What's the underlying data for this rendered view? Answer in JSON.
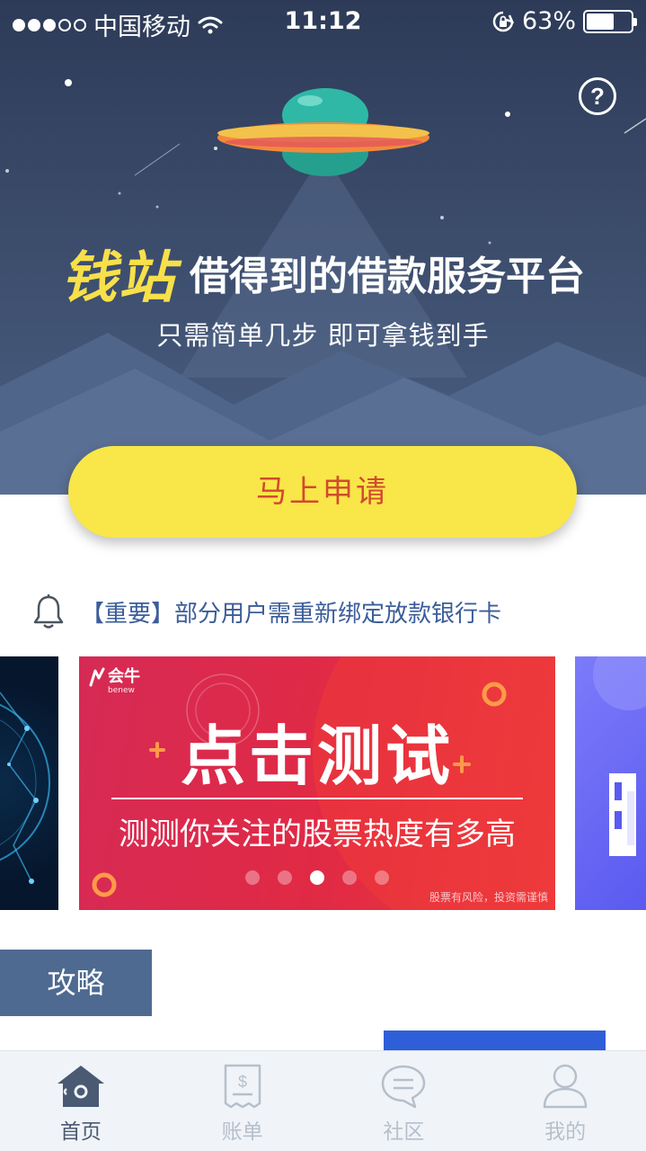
{
  "status_bar": {
    "carrier": "中国移动",
    "time": "11:12",
    "battery": "63%",
    "battery_level": 0.63
  },
  "hero": {
    "help_label": "?",
    "brand": "钱站",
    "slogan": "借得到的借款服务平台",
    "subtitle": "只需简单几步  即可拿钱到手",
    "apply_label": "马上申请"
  },
  "notice": {
    "text": "【重要】部分用户需重新绑定放款银行卡"
  },
  "carousel": {
    "logo": "会牛",
    "logo_sub": "benew",
    "title": "点击测试",
    "subtitle": "测测你关注的股票热度有多高",
    "disclaimer": "股票有风险，投资需谨慎",
    "slide_count": 5,
    "active_index": 2
  },
  "section": {
    "tab_label": "攻略"
  },
  "tab_bar": {
    "items": [
      {
        "label": "首页",
        "icon": "home-icon",
        "active": true
      },
      {
        "label": "账单",
        "icon": "bill-icon",
        "active": false
      },
      {
        "label": "社区",
        "icon": "chat-icon",
        "active": false
      },
      {
        "label": "我的",
        "icon": "user-icon",
        "active": false
      }
    ]
  },
  "colors": {
    "hero_bg": "#3b4b6a",
    "brand_yellow": "#f8e04a",
    "apply_button": "#f9e648",
    "apply_text": "#d14a2e",
    "notice_text": "#3b5d9a",
    "banner_red": "#e12a44",
    "section_tab": "#4e6a91",
    "tab_active": "#4a5a72",
    "tab_inactive": "#b6bfcb"
  }
}
